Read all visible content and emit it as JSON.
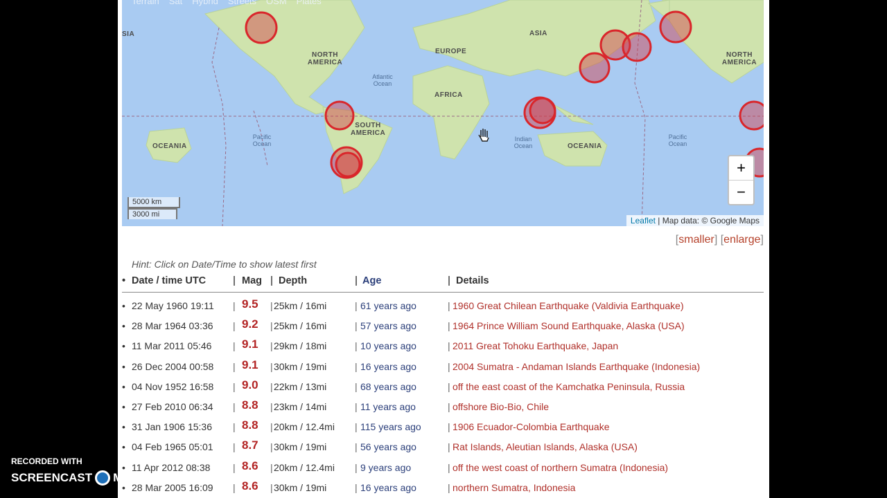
{
  "map": {
    "layer_tabs": [
      "Terrain",
      "Sat",
      "Hybrid",
      "Streets",
      "OSM",
      "Plates"
    ],
    "labels": {
      "north_america_left": "NORTH AMERICA",
      "north_america_right": "NORTH AMERICA",
      "south_america": "SOUTH AMERICA",
      "europe": "EUROPE",
      "asia": "ASIA",
      "africa": "AFRICA",
      "oceania_left": "OCEANIA",
      "oceania_right": "OCEANIA",
      "asia_left": "SIA"
    },
    "oceans": {
      "atlantic": "Atlantic Ocean",
      "pacific_left": "Pacific Ocean",
      "pacific_right": "Pacific Ocean",
      "indian": "Indian Ocean"
    },
    "zoom_in": "+",
    "zoom_out": "−",
    "scale_km": "5000 km",
    "scale_mi": "3000 mi",
    "attribution_link": "Leaflet",
    "attribution_text": "| Map data: © Google Maps"
  },
  "controls": {
    "smaller": "smaller",
    "enlarge": "enlarge"
  },
  "hint": "Hint: Click on Date/Time to show latest first",
  "table": {
    "headers": {
      "date": "Date / time UTC",
      "mag": "Mag",
      "depth": "Depth",
      "age": "Age",
      "details": "Details"
    },
    "rows": [
      {
        "date": "22 May 1960 19:11",
        "mag": "9.5",
        "depth": "25km / 16mi",
        "age": "61 years ago",
        "details": "1960 Great Chilean Earthquake (Valdivia Earthquake)"
      },
      {
        "date": "28 Mar 1964 03:36",
        "mag": "9.2",
        "depth": "25km / 16mi",
        "age": "57 years ago",
        "details": "1964 Prince William Sound Earthquake, Alaska (USA)"
      },
      {
        "date": "11 Mar 2011 05:46",
        "mag": "9.1",
        "depth": "29km / 18mi",
        "age": "10 years ago",
        "details": "2011 Great Tohoku Earthquake, Japan"
      },
      {
        "date": "26 Dec 2004 00:58",
        "mag": "9.1",
        "depth": "30km / 19mi",
        "age": "16 years ago",
        "details": "2004 Sumatra - Andaman Islands Earthquake (Indonesia)"
      },
      {
        "date": "04 Nov 1952 16:58",
        "mag": "9.0",
        "depth": "22km / 13mi",
        "age": "68 years ago",
        "details": "off the east coast of the Kamchatka Peninsula, Russia"
      },
      {
        "date": "27 Feb 2010 06:34",
        "mag": "8.8",
        "depth": "23km / 14mi",
        "age": "11 years ago",
        "details": "offshore Bio-Bio, Chile"
      },
      {
        "date": "31 Jan 1906 15:36",
        "mag": "8.8",
        "depth": "20km / 12.4mi",
        "age": "115 years ago",
        "details": "1906 Ecuador-Colombia Earthquake"
      },
      {
        "date": "04 Feb 1965 05:01",
        "mag": "8.7",
        "depth": "30km / 19mi",
        "age": "56 years ago",
        "details": "Rat Islands, Aleutian Islands, Alaska (USA)"
      },
      {
        "date": "11 Apr 2012 08:38",
        "mag": "8.6",
        "depth": "20km / 12.4mi",
        "age": "9 years ago",
        "details": "off the west coast of northern Sumatra (Indonesia)"
      },
      {
        "date": "28 Mar 2005 16:09",
        "mag": "8.6",
        "depth": "30km / 19mi",
        "age": "16 years ago",
        "details": "northern Sumatra, Indonesia"
      }
    ]
  },
  "watermark": {
    "line1": "RECORDED WITH",
    "line2a": "SCREENCAST",
    "line2b": "MATIC"
  },
  "colors": {
    "marker": "#d9262b",
    "ocean": "#a9cbf2",
    "land": "#c8dfa8",
    "magnitude": "#b22222",
    "link": "#b0302a"
  }
}
